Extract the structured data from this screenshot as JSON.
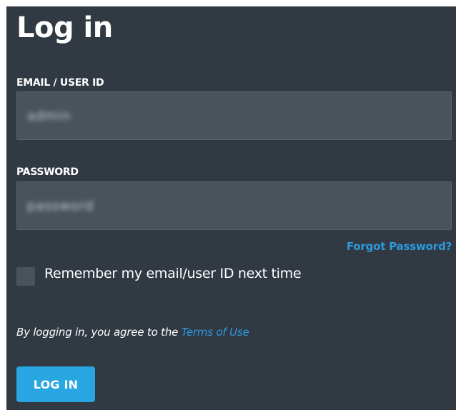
{
  "title": "Log in",
  "email": {
    "label": "EMAIL / USER ID",
    "value": "admin"
  },
  "password": {
    "label": "PASSWORD",
    "value": "password"
  },
  "forgot_password": "Forgot Password?",
  "remember": {
    "label": "Remember my email/user ID next time",
    "checked": false
  },
  "terms": {
    "prefix": "By logging in, you agree to the ",
    "link": "Terms of Use"
  },
  "login_button": "LOG IN",
  "colors": {
    "panel_bg": "#313943",
    "input_bg": "#4a535c",
    "accent": "#27a6e1",
    "link": "#2b9be0"
  }
}
